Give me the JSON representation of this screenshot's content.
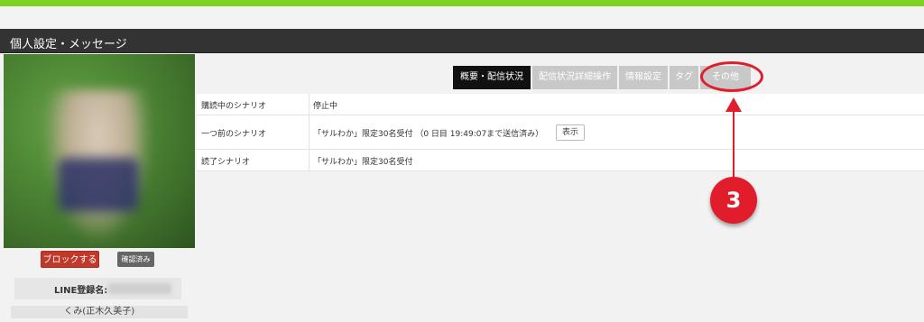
{
  "header": {
    "title": "個人設定・メッセージ"
  },
  "profile": {
    "block_label": "ブロックする",
    "confirmed_label": "確認済み",
    "line_label": "LINE登録名:",
    "user_name": "くみ(正木久美子)"
  },
  "tabs": [
    {
      "label": "概要・配信状況",
      "active": true
    },
    {
      "label": "配信状況詳細操作",
      "active": false
    },
    {
      "label": "情報設定",
      "active": false
    },
    {
      "label": "タグ",
      "active": false
    },
    {
      "label": "その他",
      "active": false
    }
  ],
  "table": {
    "rows": [
      {
        "key": "購読中のシナリオ",
        "value": "停止中"
      },
      {
        "key": "一つ前のシナリオ",
        "value": "「サルわか」限定30名受付 （0 日目 19:49:07まで送信済み）",
        "button": "表示"
      },
      {
        "key": "読了シナリオ",
        "value": "「サルわか」限定30名受付"
      }
    ]
  },
  "annotation": {
    "number": "3",
    "color": "#e11d2b"
  },
  "colors": {
    "topbar": "#7ed321",
    "header": "#333333",
    "block_button": "#c0392b"
  }
}
